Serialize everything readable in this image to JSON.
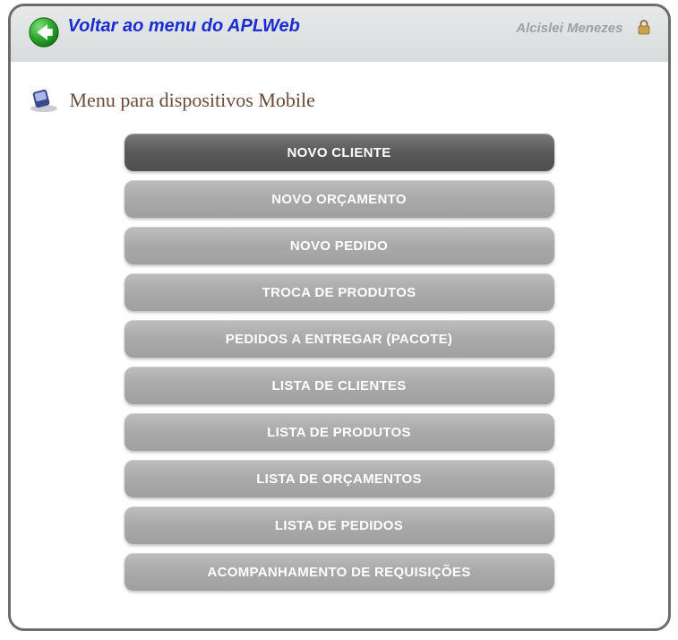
{
  "header": {
    "back_label": "Voltar ao menu do APLWeb",
    "user_name": "Alcislei Menezes"
  },
  "section": {
    "title": "Menu para dispositivos Mobile"
  },
  "menu": {
    "items": [
      {
        "label": "NOVO CLIENTE",
        "active": true
      },
      {
        "label": "NOVO ORÇAMENTO",
        "active": false
      },
      {
        "label": "NOVO PEDIDO",
        "active": false
      },
      {
        "label": "TROCA DE PRODUTOS",
        "active": false
      },
      {
        "label": "PEDIDOS A ENTREGAR (PACOTE)",
        "active": false
      },
      {
        "label": "LISTA DE CLIENTES",
        "active": false
      },
      {
        "label": "LISTA DE PRODUTOS",
        "active": false
      },
      {
        "label": "LISTA DE ORÇAMENTOS",
        "active": false
      },
      {
        "label": "LISTA DE PEDIDOS",
        "active": false
      },
      {
        "label": "ACOMPANHAMENTO DE REQUISIÇÕES",
        "active": false
      }
    ]
  }
}
